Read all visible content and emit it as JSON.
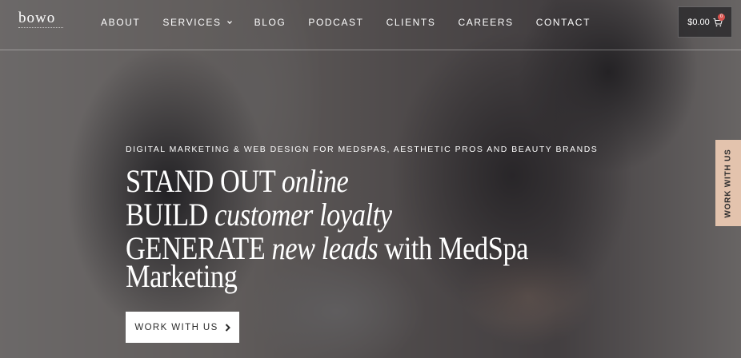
{
  "brand": {
    "logo_text": "bowo"
  },
  "nav": {
    "items": [
      {
        "label": "ABOUT"
      },
      {
        "label": "SERVICES",
        "has_dropdown": true
      },
      {
        "label": "BLOG"
      },
      {
        "label": "PODCAST"
      },
      {
        "label": "CLIENTS"
      },
      {
        "label": "CAREERS"
      },
      {
        "label": "CONTACT"
      }
    ]
  },
  "cart": {
    "total": "$0.00",
    "count": "0",
    "icon": "cart-icon",
    "badge_color": "#d9534f"
  },
  "hero": {
    "eyebrow": "DIGITAL MARKETING & WEB DESIGN FOR MEDSPAS, AESTHETIC PROS AND BEAUTY BRANDS",
    "lines": [
      {
        "normal": "STAND OUT ",
        "italic": "online",
        "tail": ""
      },
      {
        "normal": "BUILD ",
        "italic": "customer loyalty",
        "tail": ""
      },
      {
        "normal": "GENERATE ",
        "italic": "new leads",
        "tail": " with MedSpa"
      },
      {
        "normal": "Marketing",
        "italic": "",
        "tail": ""
      }
    ],
    "cta_label": "WORK WITH US",
    "cta_icon": "chevron-right-icon"
  },
  "side_tab": {
    "label": "WORK WITH US",
    "color": "#e3c3ad"
  }
}
